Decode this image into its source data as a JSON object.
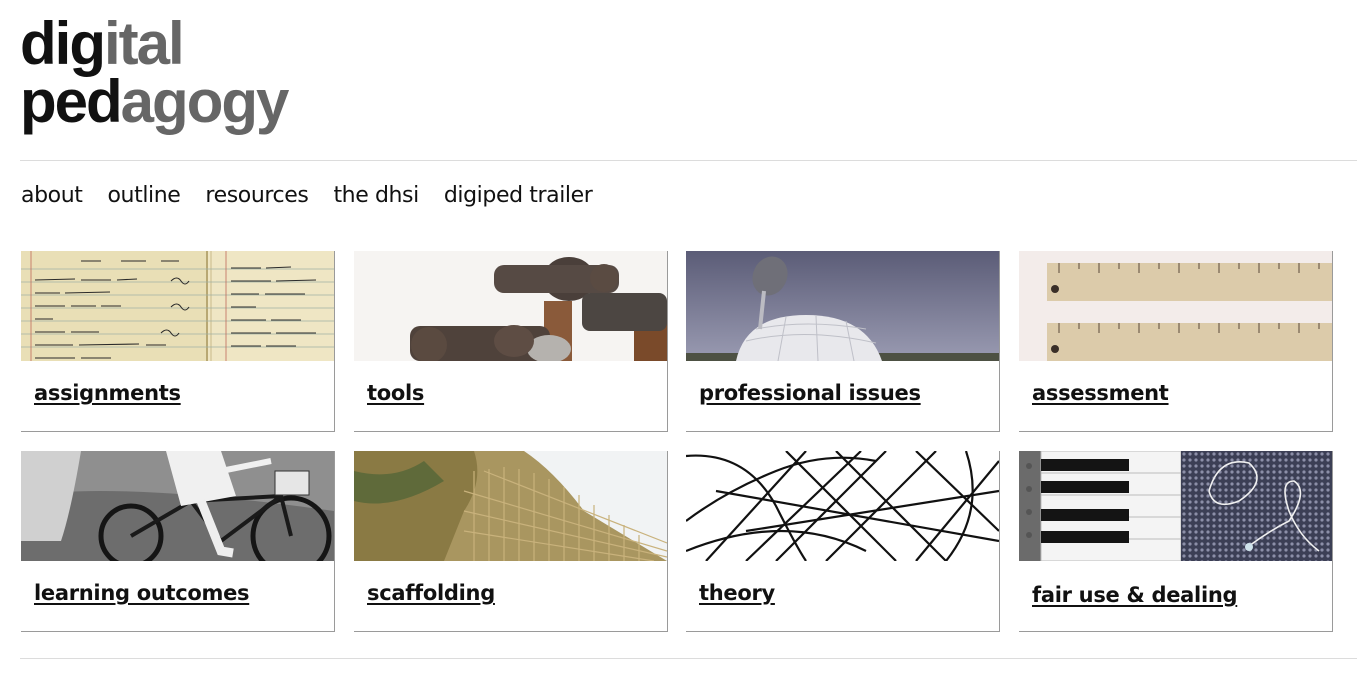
{
  "logo": {
    "line1": {
      "dark": "dig",
      "grey": "ital"
    },
    "line2": {
      "dark": "ped",
      "grey": "agogy"
    }
  },
  "nav": [
    "about",
    "outline",
    "resources",
    "the dhsi",
    "digiped trailer"
  ],
  "tiles": [
    {
      "label": "assignments",
      "image": "handwritten-ledger-image"
    },
    {
      "label": "tools",
      "image": "hammers-image"
    },
    {
      "label": "professional issues",
      "image": "satellite-dish-dome-image"
    },
    {
      "label": "assessment",
      "image": "rulers-image"
    },
    {
      "label": "learning outcomes",
      "image": "cyclist-image"
    },
    {
      "label": "scaffolding",
      "image": "bamboo-scaffolding-image"
    },
    {
      "label": "theory",
      "image": "line-pattern-image"
    },
    {
      "label": "fair use & dealing",
      "image": "piano-keys-fabric-image"
    }
  ]
}
